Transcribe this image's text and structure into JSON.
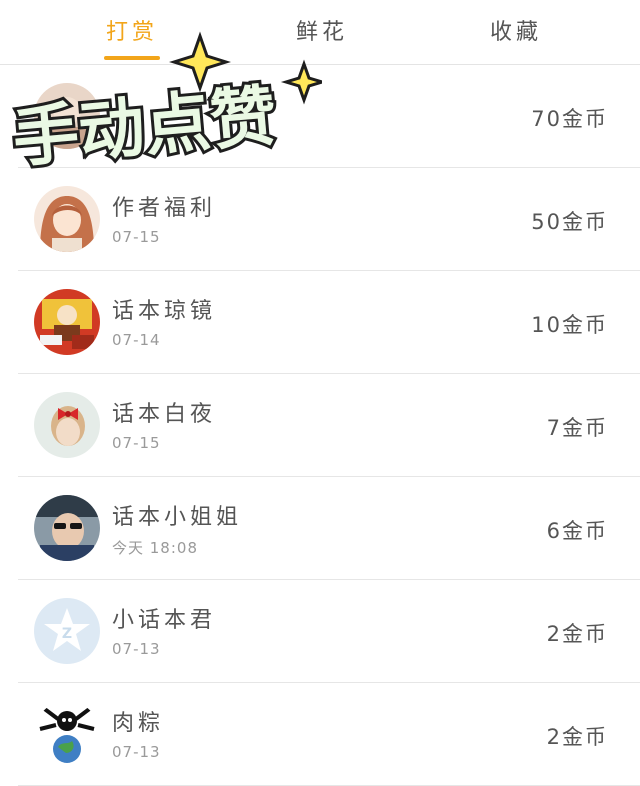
{
  "tabs": [
    {
      "label": "打赏",
      "active": true
    },
    {
      "label": "鲜花",
      "active": false
    },
    {
      "label": "收藏",
      "active": false
    }
  ],
  "colors": {
    "accent": "#f2a51a",
    "sticker_fill": "#eaf9e4",
    "sticker_outline": "#1e1e1e",
    "star": "#ffe75a"
  },
  "sticker": {
    "text": "手动点赞",
    "icon": "sparkle-star-icon"
  },
  "list": [
    {
      "name": "",
      "date": "",
      "amount": "70金币",
      "avatar": "avatar-partially-covered"
    },
    {
      "name": "作者福利",
      "date": "07-15",
      "amount": "50金币",
      "avatar": "anime-girl-avatar"
    },
    {
      "name": "话本琼镜",
      "date": "07-14",
      "amount": "10金币",
      "avatar": "illustration-avatar"
    },
    {
      "name": "话本白夜",
      "date": "07-15",
      "amount": "7金币",
      "avatar": "girl-red-bow-avatar"
    },
    {
      "name": "话本小姐姐",
      "date": "今天 18:08",
      "amount": "6金币",
      "avatar": "sunglasses-avatar"
    },
    {
      "name": "小话本君",
      "date": "07-13",
      "amount": "2金币",
      "avatar": "default-star-avatar"
    },
    {
      "name": "肉粽",
      "date": "07-13",
      "amount": "2金币",
      "avatar": "cartoon-globe-avatar"
    }
  ]
}
